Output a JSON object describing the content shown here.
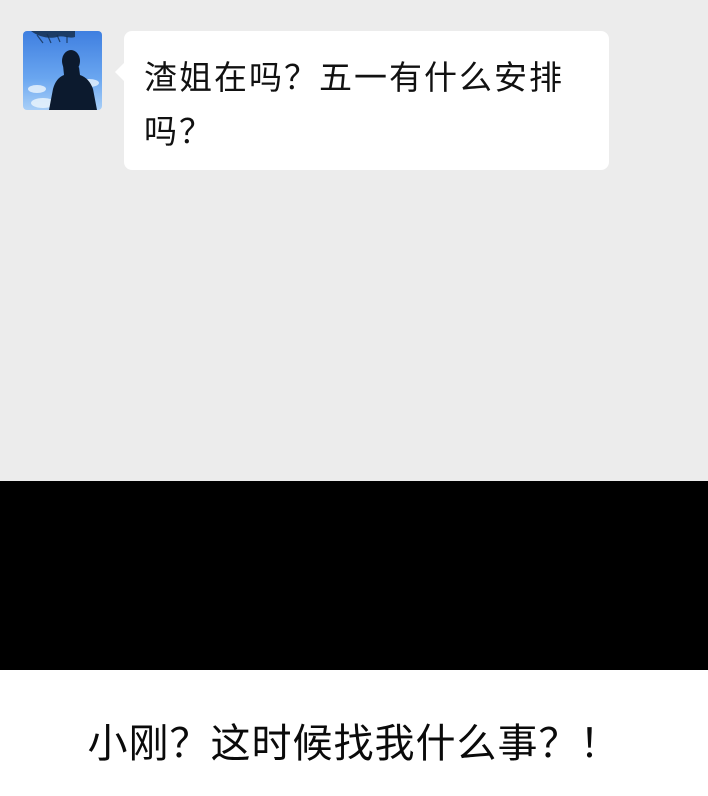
{
  "chat": {
    "background_color": "#ececec",
    "message": {
      "sender_avatar": "user-avatar-silhouette",
      "text": "渣姐在吗？五一有什么安排吗？"
    }
  },
  "panel_colors": {
    "band": "#000000",
    "caption_bg": "#ffffff"
  },
  "caption": {
    "text": "小刚？这时候找我什么事？！"
  }
}
